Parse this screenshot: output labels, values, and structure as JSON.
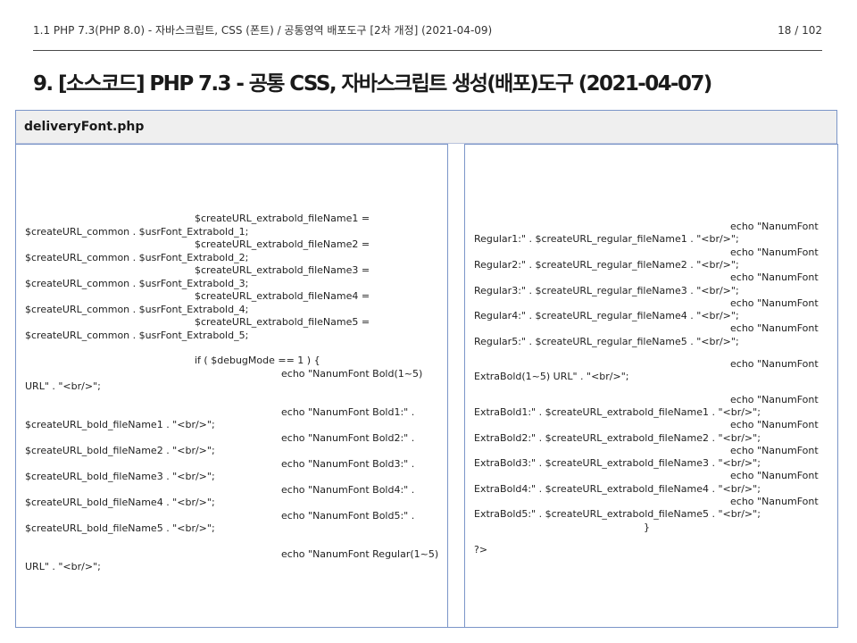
{
  "header": {
    "doc_title": "1.1 PHP 7.3(PHP 8.0) - 자바스크립트, CSS (폰트) / 공통영역 배포도구 [2차 개정] (2021-04-09)",
    "page_number": "18 / 102"
  },
  "section": {
    "heading": "9. [소스코드] PHP 7.3 - 공통 CSS, 자바스크립트 생성(배포)도구 (2021-04-07)"
  },
  "file": {
    "name": "deliveryFont.php"
  },
  "left_code": [
    {
      "text": "$createURL_extrabold_fileName1 =",
      "indent": 1
    },
    {
      "text": "$createURL_common . $usrFont_Extrabold_1;",
      "indent": 0
    },
    {
      "text": "$createURL_extrabold_fileName2 =",
      "indent": 1
    },
    {
      "text": "$createURL_common . $usrFont_Extrabold_2;",
      "indent": 0
    },
    {
      "text": "$createURL_extrabold_fileName3 =",
      "indent": 1
    },
    {
      "text": "$createURL_common . $usrFont_Extrabold_3;",
      "indent": 0
    },
    {
      "text": "$createURL_extrabold_fileName4 =",
      "indent": 1
    },
    {
      "text": "$createURL_common . $usrFont_Extrabold_4;",
      "indent": 0
    },
    {
      "text": "$createURL_extrabold_fileName5 =",
      "indent": 1
    },
    {
      "text": "$createURL_common . $usrFont_Extrabold_5;",
      "indent": 0
    },
    {
      "text": "",
      "indent": 0
    },
    {
      "text": "if ( $debugMode == 1 ) {",
      "indent": 1
    },
    {
      "text": "echo \"NanumFont Bold(1~5)",
      "indent": 2
    },
    {
      "text": "URL\" . \"<br/>\";",
      "indent": 0
    },
    {
      "text": "",
      "indent": 0
    },
    {
      "text": "echo \"NanumFont Bold1:\"  .",
      "indent": 2
    },
    {
      "text": "$createURL_bold_fileName1 . \"<br/>\";",
      "indent": 0
    },
    {
      "text": "echo \"NanumFont Bold2:\"  .",
      "indent": 2
    },
    {
      "text": "$createURL_bold_fileName2 . \"<br/>\";",
      "indent": 0
    },
    {
      "text": "echo \"NanumFont Bold3:\"  .",
      "indent": 2
    },
    {
      "text": "$createURL_bold_fileName3 . \"<br/>\";",
      "indent": 0
    },
    {
      "text": "echo \"NanumFont Bold4:\"  .",
      "indent": 2
    },
    {
      "text": "$createURL_bold_fileName4 . \"<br/>\";",
      "indent": 0
    },
    {
      "text": "echo \"NanumFont Bold5:\"  .",
      "indent": 2
    },
    {
      "text": "$createURL_bold_fileName5 . \"<br/>\";",
      "indent": 0
    },
    {
      "text": "",
      "indent": 0
    },
    {
      "text": "echo \"NanumFont Regular(1~5)",
      "indent": 2
    },
    {
      "text": "URL\" . \"<br/>\";",
      "indent": 0
    }
  ],
  "right_code": [
    {
      "text": "echo \"NanumFont",
      "indent": 1
    },
    {
      "text": "Regular1:\" . $createURL_regular_fileName1 . \"<br/>\";",
      "indent": 0
    },
    {
      "text": "echo \"NanumFont",
      "indent": 1
    },
    {
      "text": "Regular2:\" . $createURL_regular_fileName2 . \"<br/>\";",
      "indent": 0
    },
    {
      "text": "echo \"NanumFont",
      "indent": 1
    },
    {
      "text": "Regular3:\" . $createURL_regular_fileName3 . \"<br/>\";",
      "indent": 0
    },
    {
      "text": "echo \"NanumFont",
      "indent": 1
    },
    {
      "text": "Regular4:\" . $createURL_regular_fileName4 . \"<br/>\";",
      "indent": 0
    },
    {
      "text": "echo \"NanumFont",
      "indent": 1
    },
    {
      "text": "Regular5:\" . $createURL_regular_fileName5 . \"<br/>\";",
      "indent": 0
    },
    {
      "text": "",
      "indent": 0
    },
    {
      "text": "echo \"NanumFont",
      "indent": 1
    },
    {
      "text": "ExtraBold(1~5)  URL\" . \"<br/>\";",
      "indent": 0
    },
    {
      "text": "",
      "indent": 0
    },
    {
      "text": "echo \"NanumFont",
      "indent": 1
    },
    {
      "text": "ExtraBold1:\" . $createURL_extrabold_fileName1 . \"<br/>\";",
      "indent": 0
    },
    {
      "text": "echo \"NanumFont",
      "indent": 1
    },
    {
      "text": "ExtraBold2:\" . $createURL_extrabold_fileName2 . \"<br/>\";",
      "indent": 0
    },
    {
      "text": "echo \"NanumFont",
      "indent": 1
    },
    {
      "text": "ExtraBold3:\" . $createURL_extrabold_fileName3 . \"<br/>\";",
      "indent": 0
    },
    {
      "text": "echo \"NanumFont",
      "indent": 1
    },
    {
      "text": "ExtraBold4:\" . $createURL_extrabold_fileName4 . \"<br/>\";",
      "indent": 0
    },
    {
      "text": "echo \"NanumFont",
      "indent": 1
    },
    {
      "text": "ExtraBold5:\" . $createURL_extrabold_fileName5 . \"<br/>\";",
      "indent": 0
    },
    {
      "text": "}",
      "indent": 2
    },
    {
      "text": "",
      "indent": 0
    },
    {
      "text": "?>",
      "indent": 0
    }
  ]
}
